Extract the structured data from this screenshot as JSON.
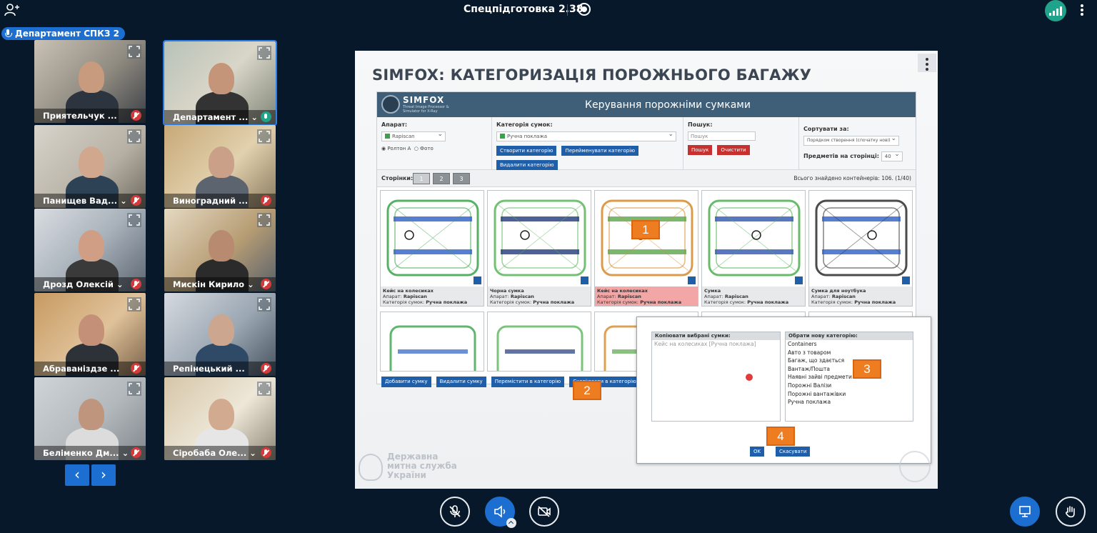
{
  "meeting": {
    "title": "Спецпідготовка 2.38"
  },
  "department_badge": "Департамент СПКЗ 2",
  "participants": [
    {
      "name": "Приятельчук ...",
      "mic": "muted"
    },
    {
      "name": "Департамент ...",
      "mic": "on",
      "active": true,
      "caret": "⌄"
    },
    {
      "name": "Панищев Вад...",
      "mic": "muted",
      "caret": "⌄"
    },
    {
      "name": "Виноградний ...",
      "mic": "muted"
    },
    {
      "name": "Дрозд Олексій",
      "mic": "muted",
      "caret": "⌄"
    },
    {
      "name": "Мискін Кирило",
      "mic": "muted",
      "caret": "⌄"
    },
    {
      "name": "Абраваніздзе ...",
      "mic": "muted"
    },
    {
      "name": "Репінецький ...",
      "mic": "muted"
    },
    {
      "name": "Беліменко Дм...",
      "mic": "muted",
      "caret": "⌄"
    },
    {
      "name": "Сіробаба Оле...",
      "mic": "muted",
      "caret": "⌄"
    }
  ],
  "pagination": {
    "prev": "‹",
    "next": "›"
  },
  "slide": {
    "title": "SIMFOX: КАТЕГОРИЗАЦІЯ ПОРОЖНЬОГО БАГАЖУ",
    "footer_text": [
      "Державна",
      "митна служба",
      "України"
    ]
  },
  "app": {
    "logo_name": "SIMFOX",
    "logo_sub": "Threat Image Processor & Simulator for X-Ray",
    "header_title": "Керування порожніми сумками",
    "filters": {
      "device_label": "Апарат:",
      "device_value": "Rapiscan",
      "radio_1": "◉ Ролтон А",
      "radio_2": "○ Фото",
      "category_label": "Категорія сумок:",
      "category_value": "Ручна поклажа",
      "btn_create": "Створити категорію",
      "btn_rename": "Перейменувати категорію",
      "btn_delete": "Видалити категорію",
      "search_label": "Пошук:",
      "search_placeholder": "Пошук",
      "btn_search": "Пошук",
      "btn_clear": "Очистити",
      "sort_label": "Сортувати за:",
      "sort_value": "Порядком створення (спочатку нові)",
      "per_page_label": "Предметів на сторінці:",
      "per_page_value": "40"
    },
    "pager": {
      "label": "Сторінки:",
      "pages": [
        "1",
        "2",
        "3"
      ],
      "total_text": "Всього знайдено контейнерів: 106. (1/40)"
    },
    "cards": [
      {
        "title": "Кейс на колесиках",
        "device_label": "Апарат:",
        "device": "Rapiscan",
        "cat_label": "Категорія сумок:",
        "cat": "Ручна поклажа"
      },
      {
        "title": "Чорна сумка",
        "device_label": "Апарат:",
        "device": "Rapiscan",
        "cat_label": "Категорія сумок:",
        "cat": "Ручна поклажа"
      },
      {
        "title": "Кейс на колесиках",
        "device_label": "Апарат:",
        "device": "Rapiscan",
        "cat_label": "Категорія сумок:",
        "cat": "Ручна поклажа",
        "selected": true
      },
      {
        "title": "Сумка",
        "device_label": "Апарат:",
        "device": "Rapiscan",
        "cat_label": "Категорія сумок:",
        "cat": "Ручна поклажа"
      },
      {
        "title": "Сумка для ноутбука",
        "device_label": "Апарат:",
        "device": "Rapiscan",
        "cat_label": "Категорія сумок:",
        "cat": "Ручна поклажа"
      }
    ],
    "actions": {
      "add": "Добавити сумку",
      "delete": "Видалити сумку",
      "move": "Перемістити в категорію",
      "copy": "Скопіювати в категорію"
    },
    "dialog": {
      "left_header": "Копіювати вибрані сумки:",
      "left_items": [
        "Кейс на колесиках [Ручна поклажа]"
      ],
      "right_header": "Обрати нову категорію:",
      "right_items": [
        "Containers",
        "Авто з товаром",
        "Багаж, що здається",
        "Вантаж/Пошта",
        "Наявні зайві предмети",
        "Порожні Валізи",
        "Порожні вантажівки",
        "Ручна поклажа"
      ],
      "ok": "OK",
      "cancel": "Скасувати"
    },
    "markers": [
      "1",
      "2",
      "3",
      "4"
    ]
  },
  "controls": {
    "mic_icon": "mic-off-icon",
    "speaker_icon": "speaker-icon",
    "camera_icon": "camera-off-icon",
    "present_icon": "presentation-icon",
    "hand_icon": "raise-hand-icon"
  },
  "colors": {
    "background": "#07182a",
    "accent_blue": "#1c6fd1",
    "mic_on": "#1fa38a",
    "mic_off": "#d43a3a",
    "marker_orange": "#ee7d22"
  }
}
